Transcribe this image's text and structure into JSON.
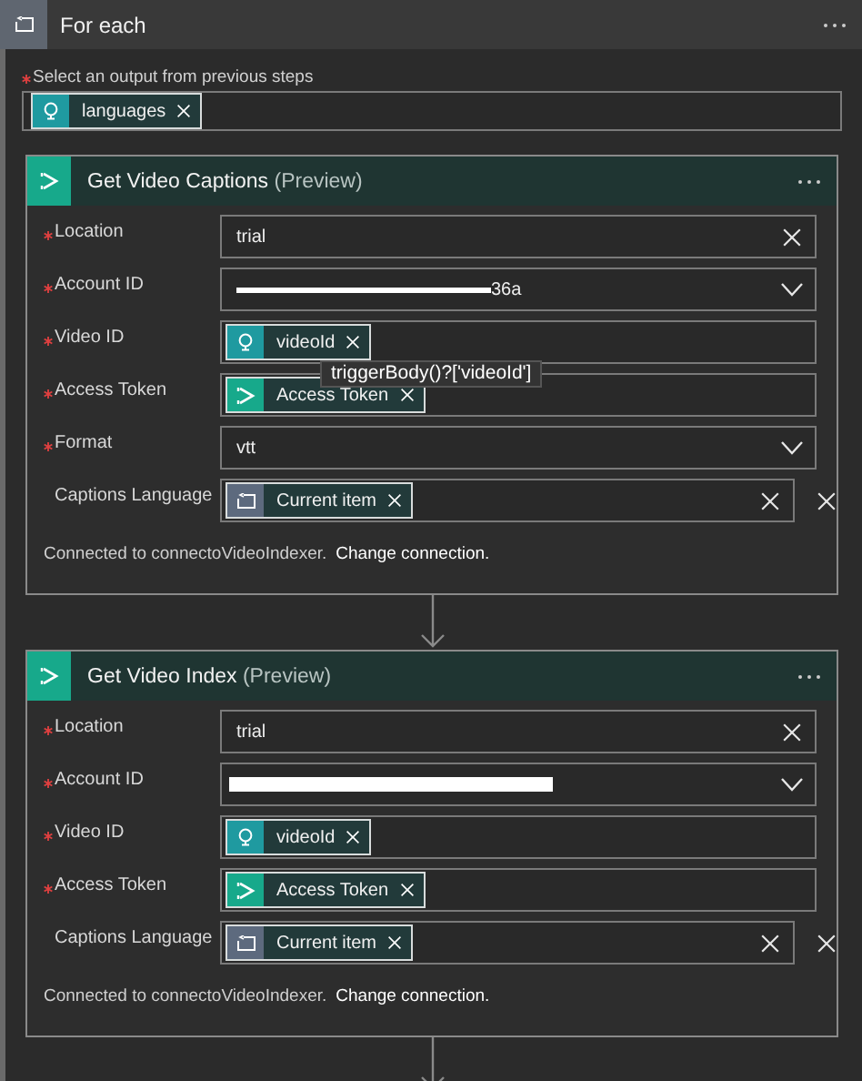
{
  "loop": {
    "title": "For each",
    "input": {
      "label": "Select an output from previous steps",
      "required": true,
      "tokens": [
        {
          "kind": "output",
          "label": "languages"
        }
      ]
    }
  },
  "actions": [
    {
      "title": "Get Video Captions",
      "tag": "(Preview)",
      "fields": [
        {
          "label": "Location",
          "required": true,
          "value": "trial",
          "clearable": true,
          "dropdown": false,
          "removable": false
        },
        {
          "label": "Account ID",
          "required": true,
          "redacted": true,
          "value": "36a",
          "clearable": false,
          "dropdown": true,
          "removable": false
        },
        {
          "label": "Video ID",
          "required": true,
          "tokens": [
            {
              "kind": "output",
              "label": "videoId",
              "tooltip": "triggerBody()?['videoId']"
            }
          ],
          "clearable": false,
          "dropdown": false,
          "removable": false
        },
        {
          "label": "Access Token",
          "required": true,
          "tokens": [
            {
              "kind": "action",
              "label": "Access Token"
            }
          ],
          "clearable": false,
          "dropdown": false,
          "removable": false
        },
        {
          "label": "Format",
          "required": true,
          "value": "vtt",
          "clearable": false,
          "dropdown": true,
          "removable": false
        },
        {
          "label": "Captions Language",
          "required": false,
          "tokens": [
            {
              "kind": "loop",
              "label": "Current item"
            }
          ],
          "clearable": true,
          "dropdown": false,
          "removable": true
        }
      ],
      "connection": "Connected to connectoVideoIndexer.",
      "change_link": "Change connection."
    },
    {
      "title": "Get Video Index",
      "tag": "(Preview)",
      "fields": [
        {
          "label": "Location",
          "required": true,
          "value": "trial",
          "clearable": true,
          "dropdown": false,
          "removable": false
        },
        {
          "label": "Account ID",
          "required": true,
          "redacted": true,
          "clearable": false,
          "dropdown": true,
          "removable": false
        },
        {
          "label": "Video ID",
          "required": true,
          "tokens": [
            {
              "kind": "output",
              "label": "videoId"
            }
          ],
          "clearable": false,
          "dropdown": false,
          "removable": false
        },
        {
          "label": "Access Token",
          "required": true,
          "tokens": [
            {
              "kind": "action",
              "label": "Access Token"
            }
          ],
          "clearable": false,
          "dropdown": false,
          "removable": false
        },
        {
          "label": "Captions Language",
          "required": false,
          "tokens": [
            {
              "kind": "loop",
              "label": "Current item"
            }
          ],
          "clearable": true,
          "dropdown": false,
          "removable": true
        }
      ],
      "connection": "Connected to connectoVideoIndexer.",
      "change_link": "Change connection."
    }
  ]
}
